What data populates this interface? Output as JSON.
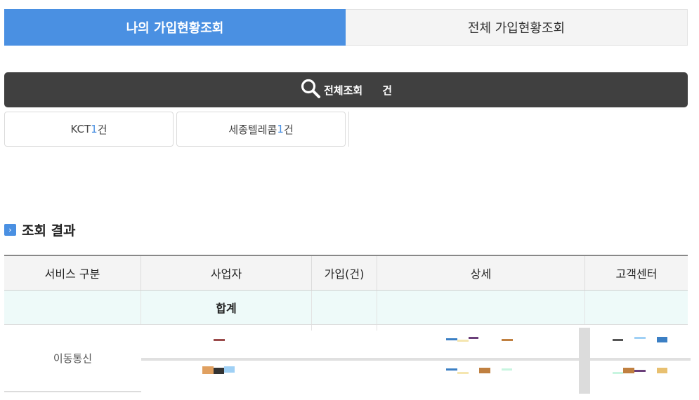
{
  "tabs": [
    {
      "label": "나의 가입현황조회",
      "active": true
    },
    {
      "label": "전체 가입현황조회",
      "active": false
    }
  ],
  "search_all": {
    "label": "전체조회",
    "count": "",
    "unit": "건",
    "icon": "search-icon"
  },
  "carriers": [
    {
      "name": "KCT",
      "count": "1",
      "unit": "건"
    },
    {
      "name": "세종텔레콤",
      "count": "1",
      "unit": "건"
    }
  ],
  "results": {
    "title": "조회 결과",
    "bullet_icon": "chevron-right-icon"
  },
  "table": {
    "headers": [
      "서비스 구분",
      "사업자",
      "가입(건)",
      "상세",
      "고객센터"
    ],
    "total_label": "합계",
    "rows": [
      {
        "service": "이동통신"
      }
    ]
  },
  "colors": {
    "accent": "#4a90e2",
    "dark_bar": "#404040",
    "total_row_bg": "#eefaf9"
  }
}
